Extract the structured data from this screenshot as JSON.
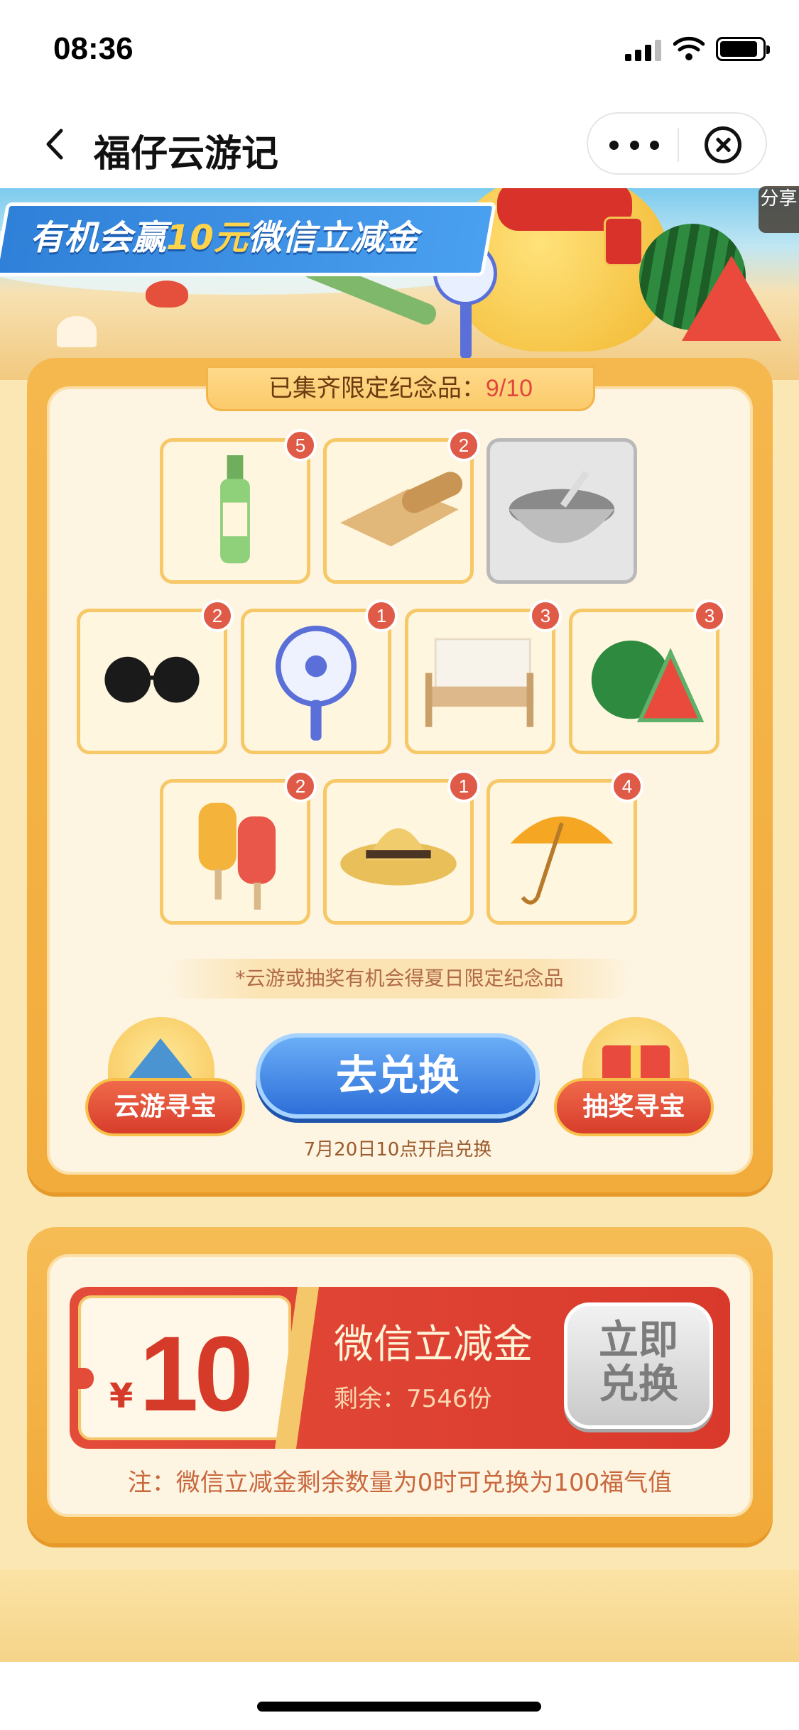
{
  "status_bar": {
    "time": "08:36"
  },
  "nav": {
    "title": "福仔云游记"
  },
  "banner": {
    "prefix": "有机会赢",
    "highlight": "10元",
    "suffix": "微信立减金",
    "share_label": "分享"
  },
  "collection": {
    "header_label": "已集齐限定纪念品：",
    "count": "9/10",
    "items": [
      {
        "name": "花露水",
        "count": "5",
        "icon": "toilet-water-bottle"
      },
      {
        "name": "凉席",
        "count": "2",
        "icon": "bamboo-mat"
      },
      {
        "name": "绿豆汤",
        "count": "",
        "icon": "mung-bean-soup",
        "collected": false
      },
      {
        "name": "墨镜",
        "count": "2",
        "icon": "sunglasses"
      },
      {
        "name": "小风扇",
        "count": "1",
        "icon": "handheld-fan"
      },
      {
        "name": "蚊帐床",
        "count": "3",
        "icon": "mosquito-net-bed"
      },
      {
        "name": "西瓜",
        "count": "3",
        "icon": "watermelon"
      },
      {
        "name": "冰棍",
        "count": "2",
        "icon": "popsicles"
      },
      {
        "name": "草帽",
        "count": "1",
        "icon": "straw-hat"
      },
      {
        "name": "雨伞",
        "count": "4",
        "icon": "umbrella"
      }
    ],
    "hint": "*云游或抽奖有机会得夏日限定纪念品",
    "cloud_tour_button": "云游寻宝",
    "lottery_button": "抽奖寻宝",
    "exchange_button": "去兑换",
    "exchange_note": "7月20日10点开启兑换"
  },
  "coupon": {
    "currency": "¥",
    "amount": "10",
    "title": "微信立减金",
    "remain_label": "剩余：",
    "remain_value": "7546份",
    "redeem_line1": "立即",
    "redeem_line2": "兑换",
    "note": "注：微信立减金剩余数量为0时可兑换为100福气值"
  },
  "colors": {
    "accent_red": "#d9392b",
    "accent_blue": "#2d6fd9",
    "panel_orange": "#f2ac3c"
  }
}
